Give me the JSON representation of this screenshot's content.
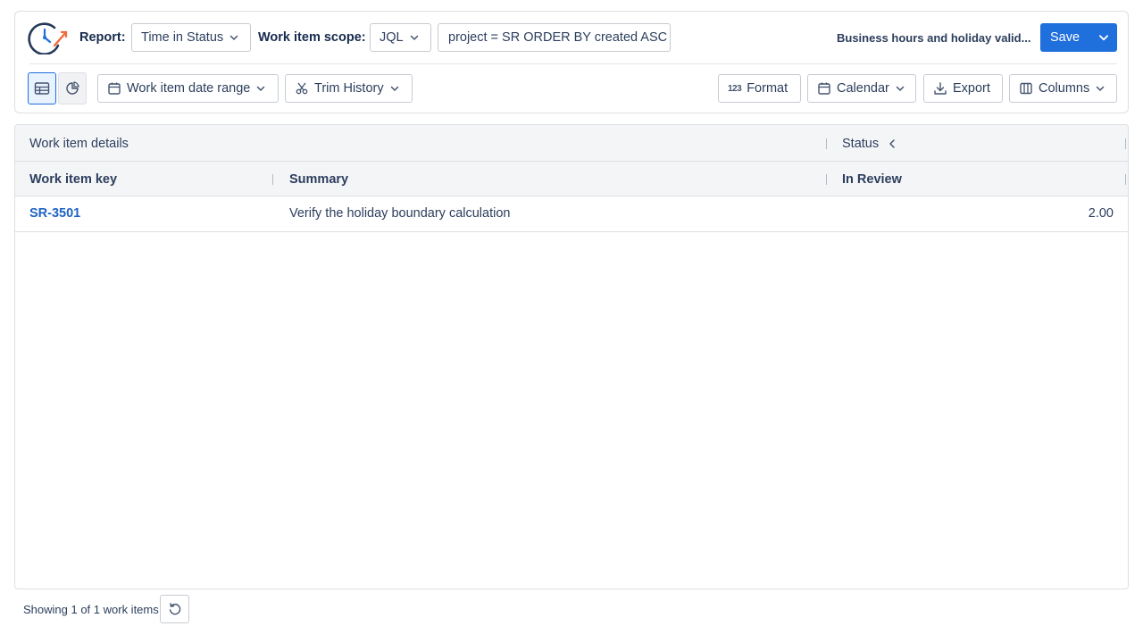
{
  "header": {
    "report_label": "Report:",
    "report_value": "Time in Status",
    "scope_label": "Work item scope:",
    "scope_type": "JQL",
    "jql_query": "project = SR ORDER BY created ASC",
    "calendar_name": "Business hours and holiday valid...",
    "save_label": "Save"
  },
  "toolbar": {
    "date_range_label": "Work item date range",
    "trim_history_label": "Trim History",
    "format_label": "Format",
    "calendar_label": "Calendar",
    "export_label": "Export",
    "columns_label": "Columns",
    "active_view": "table"
  },
  "grid": {
    "group_headers": [
      "Work item details",
      "Status"
    ],
    "columns": [
      "Work item key",
      "Summary",
      "In Review"
    ],
    "rows": [
      {
        "key": "SR-3501",
        "summary": "Verify the holiday boundary calculation",
        "in_review": "2.00"
      }
    ]
  },
  "footer": {
    "showing_text": "Showing 1 of 1 work items"
  },
  "colors": {
    "accent": "#1f6fdc",
    "link": "#1f63c4",
    "border": "#dcdfe4"
  }
}
